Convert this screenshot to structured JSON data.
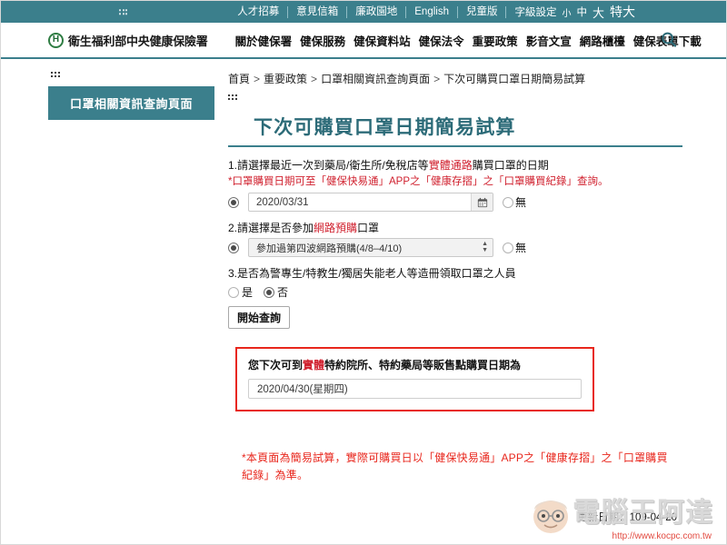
{
  "topbar": {
    "links": [
      {
        "label": "人才招募"
      },
      {
        "label": "意見信箱"
      },
      {
        "label": "廉政園地"
      },
      {
        "label": "English"
      },
      {
        "label": "兒童版"
      }
    ],
    "fontsize_label": "字級設定",
    "fontsize_options": [
      "小",
      "中",
      "大",
      "特大"
    ]
  },
  "header": {
    "logo_letter": "H",
    "brand": "衛生福利部中央健康保險署",
    "nav": [
      "關於健保署",
      "健保服務",
      "健保資料站",
      "健保法令",
      "重要政策",
      "影音文宣",
      "網路櫃檯",
      "健保表單下載"
    ],
    "search_icon": "search-icon"
  },
  "sidebar": {
    "title": "口罩相關資訊查詢頁面"
  },
  "breadcrumb": {
    "items": [
      "首頁",
      "重要政策",
      "口罩相關資訊查詢頁面",
      "下次可購買口罩日期簡易試算"
    ],
    "separator": ">"
  },
  "page": {
    "title": "下次可購買口罩日期簡易試算"
  },
  "form": {
    "q1": {
      "prefix": "1.請選擇最近一次到藥局/衛生所/免稅店等",
      "highlight": "實體通路",
      "suffix": "購買口罩的日期",
      "note": "*口罩購買日期可至「健保快易通」APP之「健康存摺」之「口罩購買紀錄」查詢。",
      "date_value": "2020/03/31",
      "calendar_icon": "calendar-icon",
      "none_label": "無"
    },
    "q2": {
      "prefix": "2.請選擇是否參加",
      "highlight": "網路預購",
      "suffix": "口罩",
      "select_value": "參加過第四波網路預購(4/8–4/10)",
      "none_label": "無"
    },
    "q3": {
      "text": "3.是否為警專生/特教生/獨居失能老人等造冊領取口罩之人員",
      "yes_label": "是",
      "no_label": "否"
    },
    "submit_label": "開始查詢"
  },
  "result": {
    "label_prefix": "您下次可到",
    "label_highlight": "實體",
    "label_suffix": "特約院所、特約藥局等販售點購買日期為",
    "value": "2020/04/30(星期四)"
  },
  "footnote": "*本頁面為簡易試算，實際可購買日以「健保快易通」APP之「健康存摺」之「口罩購買紀錄」為準。",
  "footer": {
    "updated_label": "更新日期：",
    "updated_value": "109-04-20"
  },
  "watermark": {
    "text": "電腦王阿達",
    "url": "http://www.kocpc.com.tw"
  },
  "colors": {
    "teal": "#3b7f8c",
    "title_teal": "#2c6b78",
    "red": "#d0202e",
    "alert_red": "#e8261c"
  }
}
